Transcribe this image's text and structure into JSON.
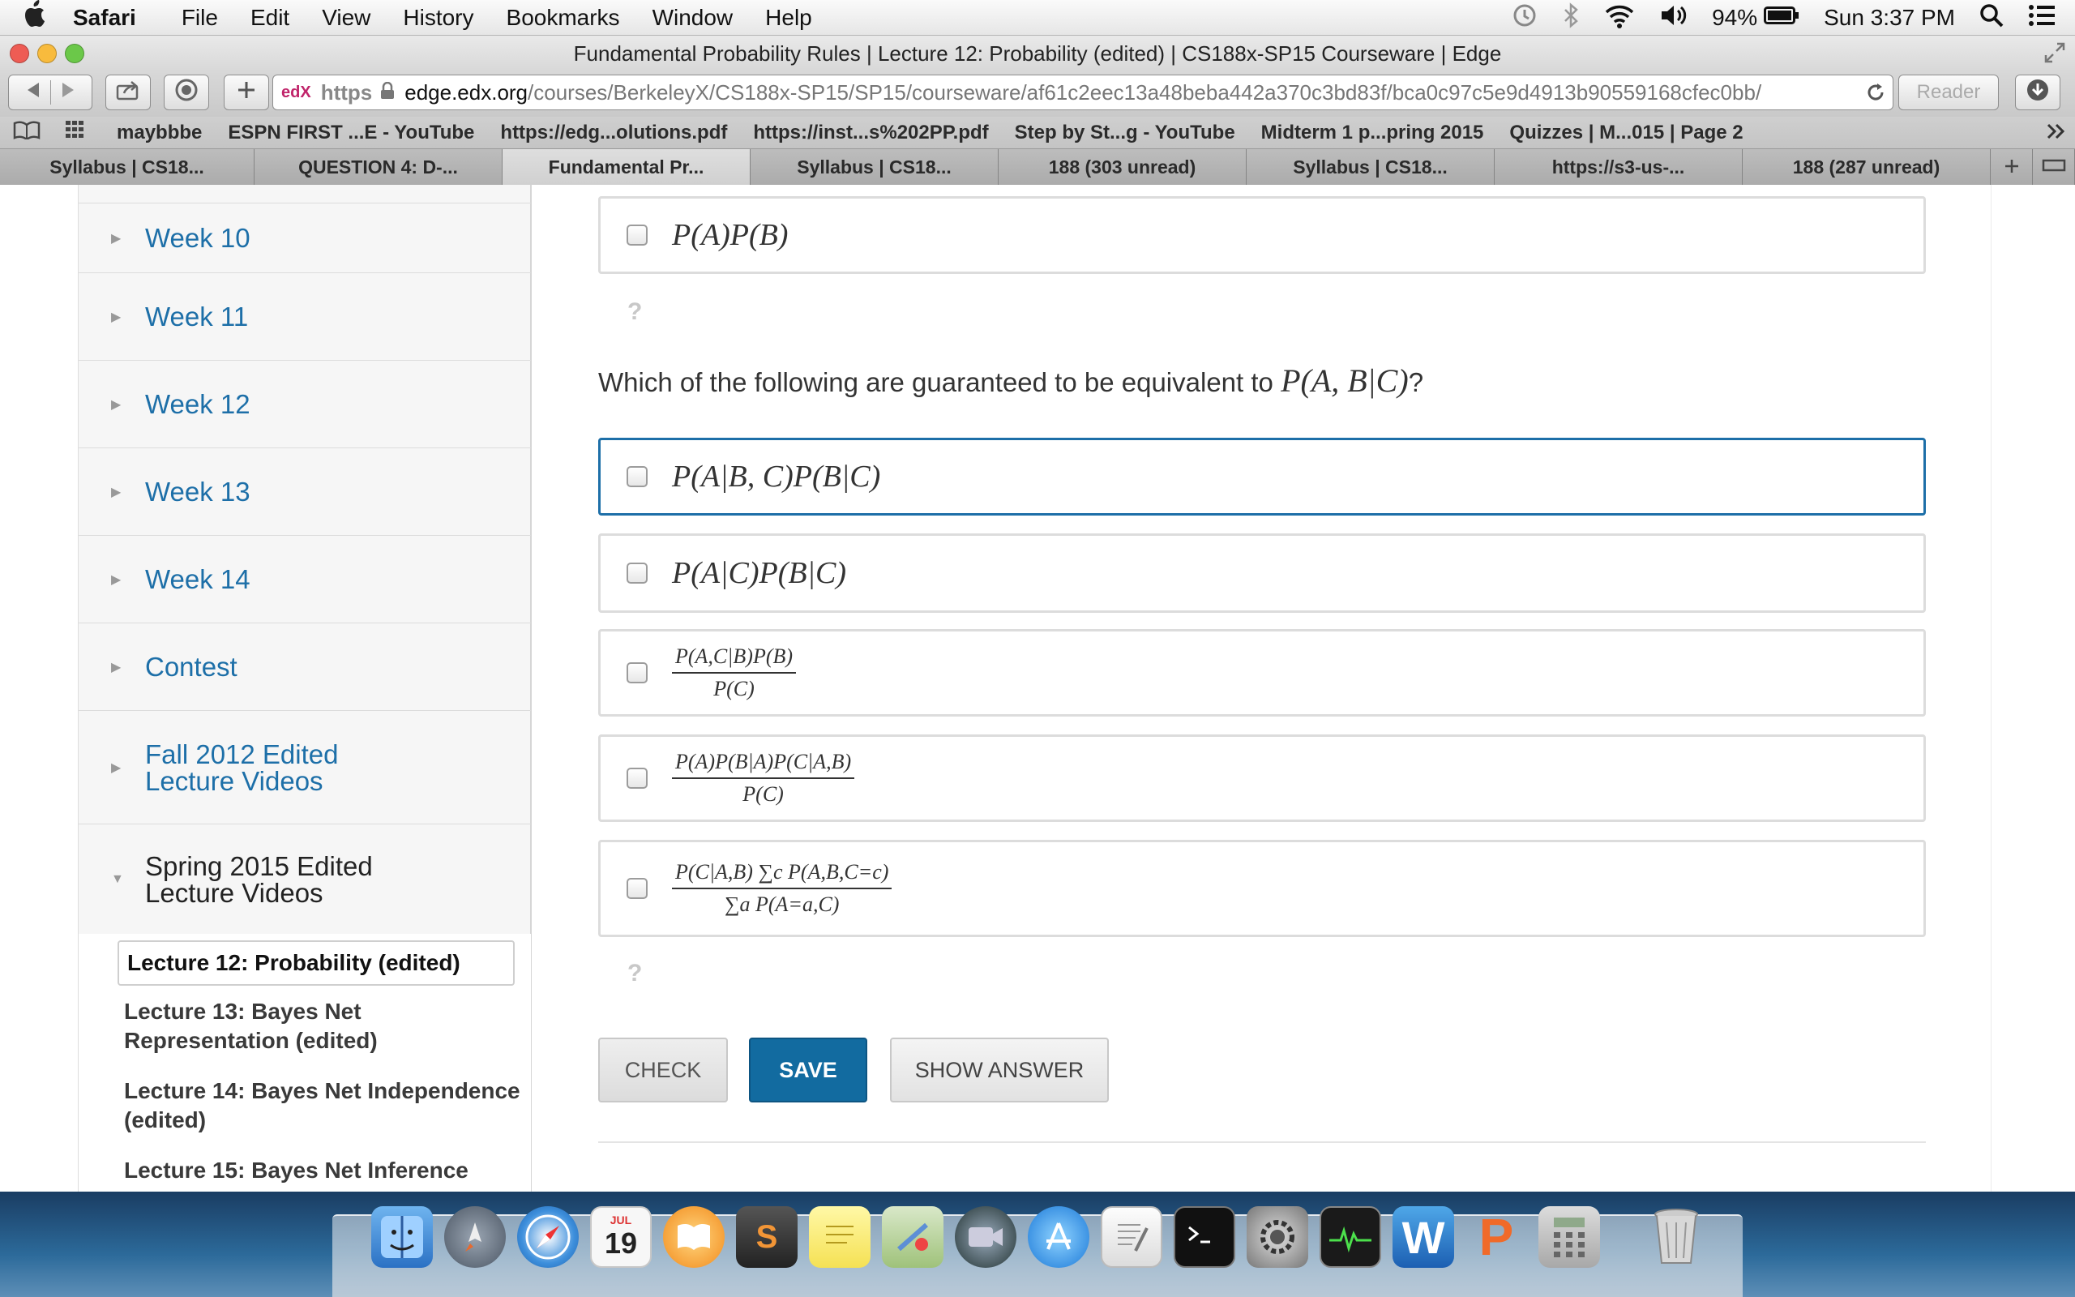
{
  "menubar": {
    "apple": "",
    "app_name": "Safari",
    "items": [
      "File",
      "Edit",
      "View",
      "History",
      "Bookmarks",
      "Window",
      "Help"
    ],
    "battery": "94%",
    "clock": "Sun 3:37 PM"
  },
  "window": {
    "title": "Fundamental Probability Rules | Lecture 12: Probability (edited) | CS188x-SP15 Courseware | Edge"
  },
  "toolbar": {
    "url_scheme": "https",
    "url_host": "edge.edx.org",
    "url_path": "/courses/BerkeleyX/CS188x-SP15/SP15/courseware/af61c2eec13a48beba442a370c3bd83f/bca0c97c5e9d4913b90559168cfec0bb/",
    "reader_label": "Reader",
    "edx_badge": "edX"
  },
  "bookmarks": [
    "maybbbe",
    "ESPN FIRST ...E - YouTube",
    "https://edg...olutions.pdf",
    "https://inst...s%202PP.pdf",
    "Step by St...g - YouTube",
    "Midterm 1 p...pring 2015",
    "Quizzes | M...015 | Page 2"
  ],
  "tabs": [
    "Syllabus | CS18...",
    "QUESTION 4: D-...",
    "Fundamental Pr...",
    "Syllabus | CS18...",
    "188 (303 unread)",
    "Syllabus | CS18...",
    "https://s3-us-...",
    "188 (287 unread)"
  ],
  "sidebar": {
    "weeks": [
      "Week 10",
      "Week 11",
      "Week 12",
      "Week 13",
      "Week 14",
      "Contest"
    ],
    "fall_line1": "Fall 2012 Edited",
    "fall_line2": "Lecture Videos",
    "spring_line1": "Spring 2015 Edited",
    "spring_line2": "Lecture Videos",
    "lectures": [
      "Lecture 12: Probability (edited)",
      "Lecture 13: Bayes Net Representation (edited)",
      "Lecture 14: Bayes Net Independence (edited)",
      "Lecture 15: Bayes Net Inference"
    ]
  },
  "problem": {
    "prev_choice": "P(A)P(B)",
    "hint_mark": "?",
    "question_prefix": "Which of the following are guaranteed to be equivalent to",
    "question_math": "P(A, B|C)",
    "question_suffix": "?",
    "choices": {
      "c1": "P(A|B, C)P(B|C)",
      "c2": "P(A|C)P(B|C)",
      "c3_num": "P(A,C|B)P(B)",
      "c3_den": "P(C)",
      "c4_num": "P(A)P(B|A)P(C|A,B)",
      "c4_den": "P(C)",
      "c5_num": "P(C|A,B) ∑c P(A,B,C=c)",
      "c5_den": "∑a P(A=a,C)"
    },
    "buttons": {
      "check": "CHECK",
      "save": "SAVE",
      "show_answer": "SHOW ANSWER"
    }
  },
  "dock": {
    "calendar_month": "JUL",
    "calendar_day": "19",
    "word_letter": "W",
    "ppt_letter": "P",
    "sublime_letter": "S"
  },
  "colors": {
    "link": "#1d6fa8",
    "save_button": "#126ba0",
    "focus_border": "#1d6fa8"
  }
}
